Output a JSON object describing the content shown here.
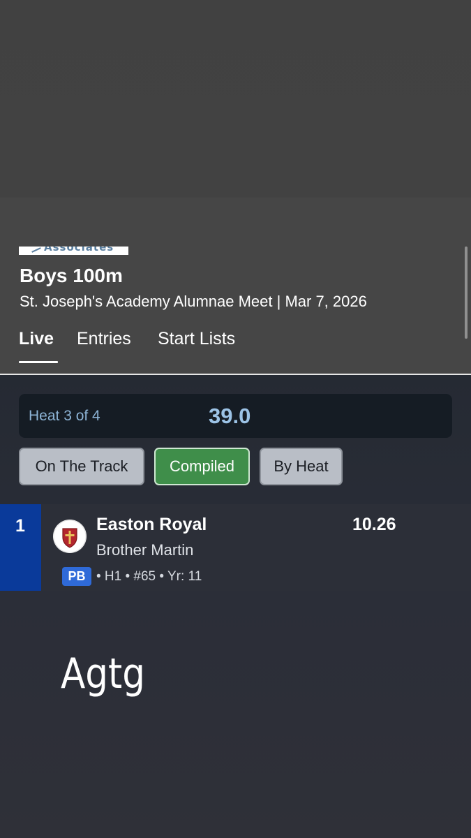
{
  "header": {
    "sponsor_logo_text": "Associates",
    "event_title": "Boys 100m",
    "meet_subtitle": "St. Joseph's Academy Alumnae Meet | Mar 7, 2026",
    "tabs": [
      {
        "label": "Live",
        "active": true
      },
      {
        "label": "Entries",
        "active": false
      },
      {
        "label": "Start Lists",
        "active": false
      }
    ]
  },
  "heat": {
    "label": "Heat 3 of 4",
    "wind": "39.0"
  },
  "view_buttons": [
    {
      "label": "On The Track",
      "selected": false
    },
    {
      "label": "Compiled",
      "selected": true
    },
    {
      "label": "By Heat",
      "selected": false
    }
  ],
  "results": [
    {
      "place": "1",
      "athlete": "Easton Royal",
      "school": "Brother Martin",
      "badge": "PB",
      "details": "• H1 • #65 • Yr: 11",
      "mark": "10.26",
      "team_logo_icon": "crusader-shield-icon"
    }
  ],
  "stray_text": "Agtg",
  "colors": {
    "header_bg": "#464646",
    "main_bg": "#2c2f38",
    "heat_bar_bg": "#151c24",
    "heat_text": "#8db4d6",
    "selected_button": "#3f8e4a",
    "unselected_button": "#b9bec6",
    "place_box": "#0a3a9a",
    "pb_badge": "#2f6ad8"
  }
}
